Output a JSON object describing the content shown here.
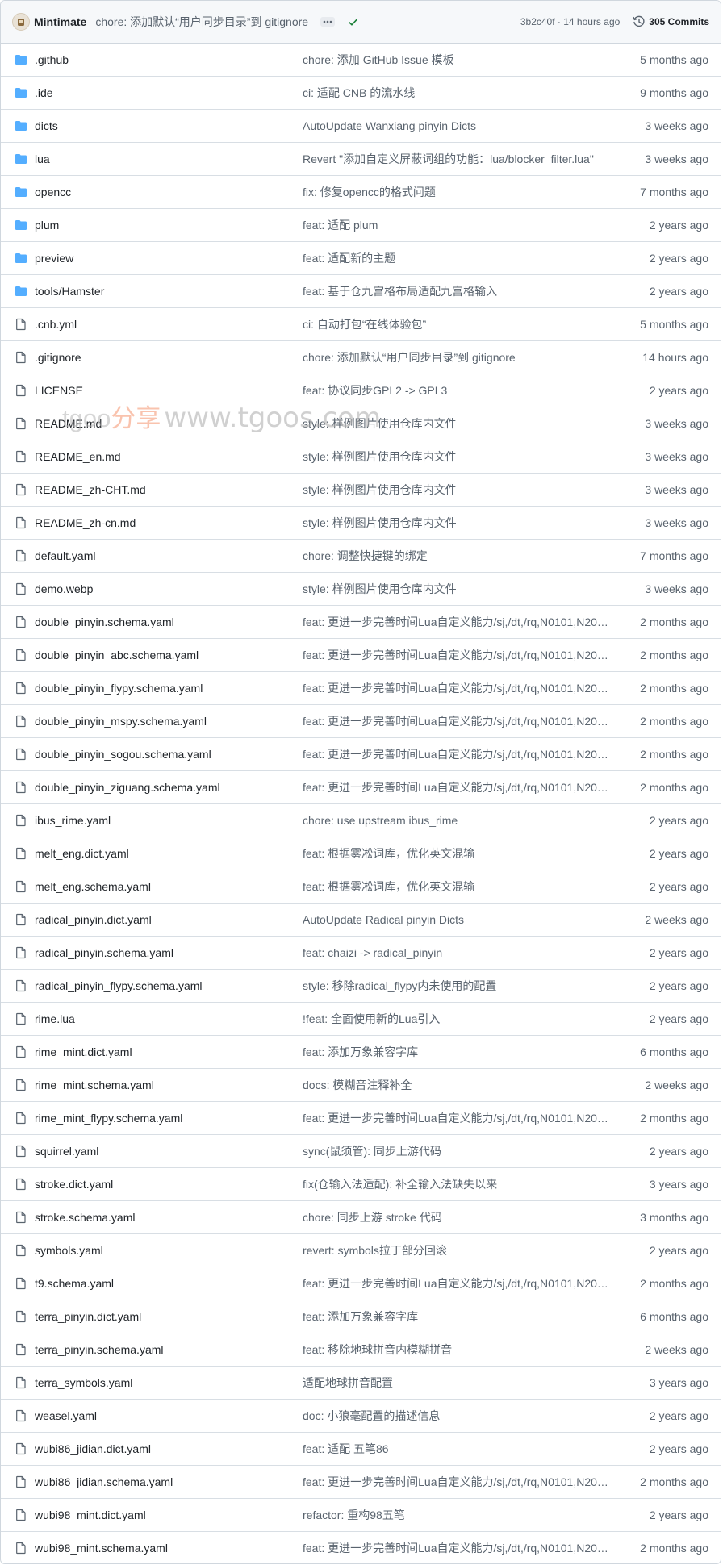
{
  "header": {
    "author": "Mintimate",
    "commit_message": "chore: 添加默认“用户同步目录”到 gitignore",
    "commit_hash": "3b2c40f",
    "separator": " · ",
    "commit_time": "14 hours ago",
    "commits_count_label": "305 Commits",
    "status_color": "#1a7f37"
  },
  "watermark": {
    "part1": "tgoo",
    "part2": "分享",
    "part3": "www.tgoos.com"
  },
  "colors": {
    "folder": "#54aeff",
    "file_outline": "#59636e"
  },
  "files": [
    {
      "type": "folder",
      "name": ".github",
      "message": "chore: 添加 GitHub Issue 模板",
      "date": "5 months ago"
    },
    {
      "type": "folder",
      "name": ".ide",
      "message": "ci: 适配 CNB 的流水线",
      "date": "9 months ago"
    },
    {
      "type": "folder",
      "name": "dicts",
      "message": "AutoUpdate Wanxiang pinyin Dicts",
      "date": "3 weeks ago"
    },
    {
      "type": "folder",
      "name": "lua",
      "message": "Revert \"添加自定义屏蔽词组的功能：lua/blocker_filter.lua\"",
      "date": "3 weeks ago"
    },
    {
      "type": "folder",
      "name": "opencc",
      "message": "fix: 修复opencc的格式问题",
      "date": "7 months ago"
    },
    {
      "type": "folder",
      "name": "plum",
      "message": "feat: 适配 plum",
      "date": "2 years ago"
    },
    {
      "type": "folder",
      "name": "preview",
      "message": "feat: 适配新的主题",
      "date": "2 years ago"
    },
    {
      "type": "folder",
      "name": "tools/Hamster",
      "message": "feat: 基于仓九宫格布局适配九宫格输入",
      "date": "2 years ago"
    },
    {
      "type": "file",
      "name": ".cnb.yml",
      "message": "ci: 自动打包“在线体验包”",
      "date": "5 months ago"
    },
    {
      "type": "file",
      "name": ".gitignore",
      "message": "chore: 添加默认“用户同步目录”到 gitignore",
      "date": "14 hours ago"
    },
    {
      "type": "file",
      "name": "LICENSE",
      "message": "feat: 协议同步GPL2 -> GPL3",
      "date": "2 years ago"
    },
    {
      "type": "file",
      "name": "README.md",
      "message": "style: 样例图片使用仓库内文件",
      "date": "3 weeks ago"
    },
    {
      "type": "file",
      "name": "README_en.md",
      "message": "style: 样例图片使用仓库内文件",
      "date": "3 weeks ago"
    },
    {
      "type": "file",
      "name": "README_zh-CHT.md",
      "message": "style: 样例图片使用仓库内文件",
      "date": "3 weeks ago"
    },
    {
      "type": "file",
      "name": "README_zh-cn.md",
      "message": "style: 样例图片使用仓库内文件",
      "date": "3 weeks ago"
    },
    {
      "type": "file",
      "name": "default.yaml",
      "message": "chore: 调整快捷键的绑定",
      "date": "7 months ago"
    },
    {
      "type": "file",
      "name": "demo.webp",
      "message": "style: 样例图片使用仓库内文件",
      "date": "3 weeks ago"
    },
    {
      "type": "file",
      "name": "double_pinyin.schema.yaml",
      "message": "feat: 更进一步完善时间Lua自定义能力/sj,/dt,/rq,N0101,N202...",
      "date": "2 months ago"
    },
    {
      "type": "file",
      "name": "double_pinyin_abc.schema.yaml",
      "message": "feat: 更进一步完善时间Lua自定义能力/sj,/dt,/rq,N0101,N202...",
      "date": "2 months ago"
    },
    {
      "type": "file",
      "name": "double_pinyin_flypy.schema.yaml",
      "message": "feat: 更进一步完善时间Lua自定义能力/sj,/dt,/rq,N0101,N202...",
      "date": "2 months ago"
    },
    {
      "type": "file",
      "name": "double_pinyin_mspy.schema.yaml",
      "message": "feat: 更进一步完善时间Lua自定义能力/sj,/dt,/rq,N0101,N202...",
      "date": "2 months ago"
    },
    {
      "type": "file",
      "name": "double_pinyin_sogou.schema.yaml",
      "message": "feat: 更进一步完善时间Lua自定义能力/sj,/dt,/rq,N0101,N202...",
      "date": "2 months ago"
    },
    {
      "type": "file",
      "name": "double_pinyin_ziguang.schema.yaml",
      "message": "feat: 更进一步完善时间Lua自定义能力/sj,/dt,/rq,N0101,N202...",
      "date": "2 months ago"
    },
    {
      "type": "file",
      "name": "ibus_rime.yaml",
      "message": "chore: use upstream ibus_rime",
      "date": "2 years ago"
    },
    {
      "type": "file",
      "name": "melt_eng.dict.yaml",
      "message": "feat: 根据雾凇词库，优化英文混输",
      "date": "2 years ago"
    },
    {
      "type": "file",
      "name": "melt_eng.schema.yaml",
      "message": "feat: 根据雾凇词库，优化英文混输",
      "date": "2 years ago"
    },
    {
      "type": "file",
      "name": "radical_pinyin.dict.yaml",
      "message": "AutoUpdate Radical pinyin Dicts",
      "date": "2 weeks ago"
    },
    {
      "type": "file",
      "name": "radical_pinyin.schema.yaml",
      "message": "feat: chaizi -> radical_pinyin",
      "date": "2 years ago"
    },
    {
      "type": "file",
      "name": "radical_pinyin_flypy.schema.yaml",
      "message": "style: 移除radical_flypy内未使用的配置",
      "date": "2 years ago"
    },
    {
      "type": "file",
      "name": "rime.lua",
      "message": "!feat: 全面使用新的Lua引入",
      "date": "2 years ago"
    },
    {
      "type": "file",
      "name": "rime_mint.dict.yaml",
      "message": "feat: 添加万象兼容字库",
      "date": "6 months ago"
    },
    {
      "type": "file",
      "name": "rime_mint.schema.yaml",
      "message": "docs: 模糊音注释补全",
      "date": "2 weeks ago"
    },
    {
      "type": "file",
      "name": "rime_mint_flypy.schema.yaml",
      "message": "feat: 更进一步完善时间Lua自定义能力/sj,/dt,/rq,N0101,N202...",
      "date": "2 months ago"
    },
    {
      "type": "file",
      "name": "squirrel.yaml",
      "message": "sync(鼠须管): 同步上游代码",
      "date": "2 years ago"
    },
    {
      "type": "file",
      "name": "stroke.dict.yaml",
      "message": "fix(仓输入法适配): 补全输入法缺失以来",
      "date": "3 years ago"
    },
    {
      "type": "file",
      "name": "stroke.schema.yaml",
      "message": "chore: 同步上游 stroke 代码",
      "date": "3 months ago"
    },
    {
      "type": "file",
      "name": "symbols.yaml",
      "message": "revert: symbols拉丁部分回滚",
      "date": "2 years ago"
    },
    {
      "type": "file",
      "name": "t9.schema.yaml",
      "message": "feat: 更进一步完善时间Lua自定义能力/sj,/dt,/rq,N0101,N202...",
      "date": "2 months ago"
    },
    {
      "type": "file",
      "name": "terra_pinyin.dict.yaml",
      "message": "feat: 添加万象兼容字库",
      "date": "6 months ago"
    },
    {
      "type": "file",
      "name": "terra_pinyin.schema.yaml",
      "message": "feat: 移除地球拼音内模糊拼音",
      "date": "2 weeks ago"
    },
    {
      "type": "file",
      "name": "terra_symbols.yaml",
      "message": "适配地球拼音配置",
      "date": "3 years ago"
    },
    {
      "type": "file",
      "name": "weasel.yaml",
      "message": "doc: 小狼毫配置的描述信息",
      "date": "2 years ago"
    },
    {
      "type": "file",
      "name": "wubi86_jidian.dict.yaml",
      "message": "feat: 适配 五笔86",
      "date": "2 years ago"
    },
    {
      "type": "file",
      "name": "wubi86_jidian.schema.yaml",
      "message": "feat: 更进一步完善时间Lua自定义能力/sj,/dt,/rq,N0101,N202...",
      "date": "2 months ago"
    },
    {
      "type": "file",
      "name": "wubi98_mint.dict.yaml",
      "message": "refactor: 重构98五笔",
      "date": "2 years ago"
    },
    {
      "type": "file",
      "name": "wubi98_mint.schema.yaml",
      "message": "feat: 更进一步完善时间Lua自定义能力/sj,/dt,/rq,N0101,N202...",
      "date": "2 months ago"
    }
  ]
}
